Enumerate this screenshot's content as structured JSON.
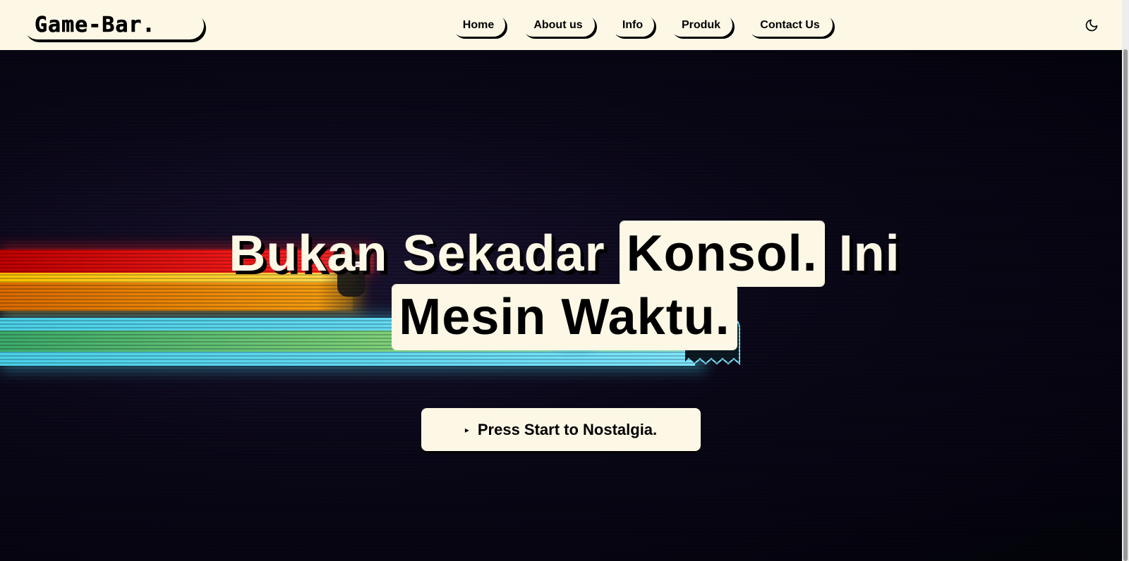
{
  "navbar": {
    "logo": "Game-Bar.",
    "links": [
      "Home",
      "About us",
      "Info",
      "Produk",
      "Contact Us"
    ],
    "theme_toggle_icon": "moon-icon"
  },
  "hero": {
    "headline_part1": "Bukan Sekadar ",
    "headline_highlight1": "Konsol.",
    "headline_part2": " Ini ",
    "headline_highlight2": "Mesin Waktu.",
    "cta_icon": "play-triangle-icon",
    "cta_label": "Press Start to Nostalgia.",
    "background_icons": [
      "rainbow-speed-trail",
      "pacman-ghost-icon"
    ]
  },
  "colors": {
    "cream": "#fdf8e6",
    "black": "#000000",
    "hero_dark": "#0a0718"
  }
}
